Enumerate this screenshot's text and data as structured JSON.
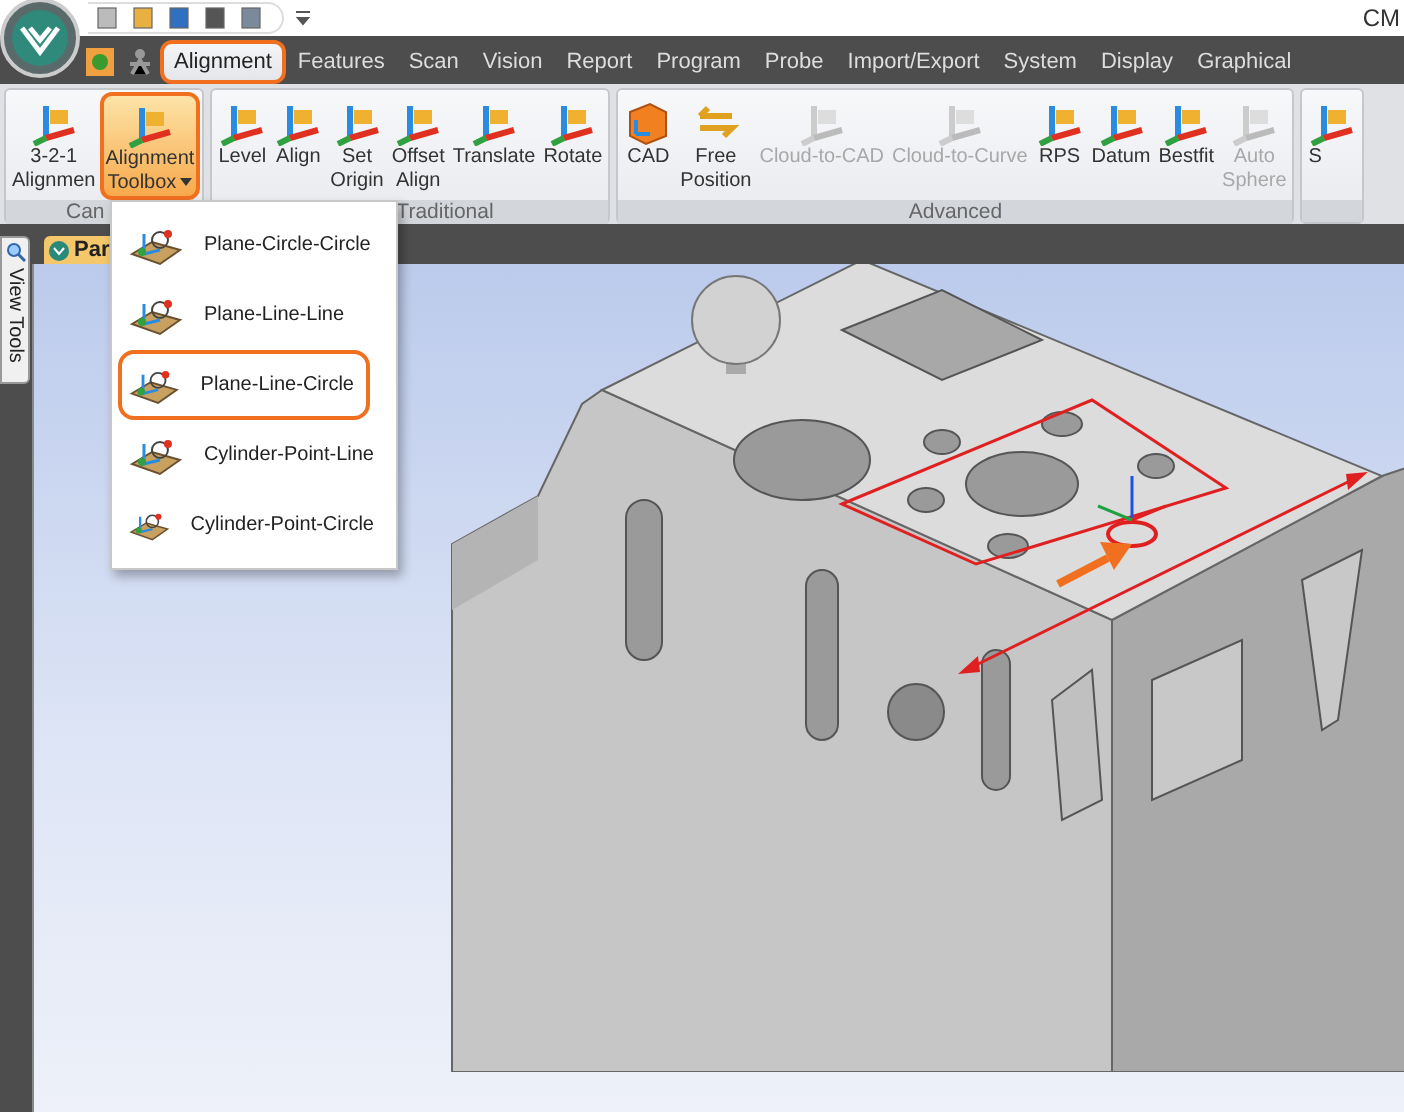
{
  "window": {
    "title": "CM"
  },
  "tabs": [
    {
      "label": "Alignment",
      "selected": true,
      "highlighted": true
    },
    {
      "label": "Features",
      "selected": false,
      "highlighted": false
    },
    {
      "label": "Scan",
      "selected": false,
      "highlighted": false
    },
    {
      "label": "Vision",
      "selected": false,
      "highlighted": false
    },
    {
      "label": "Report",
      "selected": false,
      "highlighted": false
    },
    {
      "label": "Program",
      "selected": false,
      "highlighted": false
    },
    {
      "label": "Probe",
      "selected": false,
      "highlighted": false
    },
    {
      "label": "Import/Export",
      "selected": false,
      "highlighted": false
    },
    {
      "label": "System",
      "selected": false,
      "highlighted": false
    },
    {
      "label": "Display",
      "selected": false,
      "highlighted": false
    },
    {
      "label": "Graphical",
      "selected": false,
      "highlighted": false
    }
  ],
  "ribbon_groups": [
    {
      "label": "Can",
      "buttons": [
        {
          "label": "3-2-1\nAlignmen",
          "active": false,
          "disabled": false,
          "highlighted": false
        },
        {
          "label": "Alignment\nToolbox",
          "dropdown": true,
          "active": true,
          "disabled": false,
          "highlighted": true
        }
      ]
    },
    {
      "label": "Traditional",
      "buttons": [
        {
          "label": "Level",
          "active": false,
          "disabled": false,
          "highlighted": false
        },
        {
          "label": "Align",
          "active": false,
          "disabled": false,
          "highlighted": false
        },
        {
          "label": "Set\nOrigin",
          "active": false,
          "disabled": false,
          "highlighted": false
        },
        {
          "label": "Offset\nAlign",
          "active": false,
          "disabled": false,
          "highlighted": false
        },
        {
          "label": "Translate",
          "active": false,
          "disabled": false,
          "highlighted": false
        },
        {
          "label": "Rotate",
          "active": false,
          "disabled": false,
          "highlighted": false
        }
      ]
    },
    {
      "label": "Advanced",
      "buttons": [
        {
          "label": "CAD",
          "active": false,
          "disabled": false,
          "highlighted": false
        },
        {
          "label": "Free\nPosition",
          "active": false,
          "disabled": false,
          "highlighted": false
        },
        {
          "label": "Cloud-to-CAD",
          "active": false,
          "disabled": true,
          "highlighted": false
        },
        {
          "label": "Cloud-to-Curve",
          "active": false,
          "disabled": true,
          "highlighted": false
        },
        {
          "label": "RPS",
          "active": false,
          "disabled": false,
          "highlighted": false
        },
        {
          "label": "Datum",
          "active": false,
          "disabled": false,
          "highlighted": false
        },
        {
          "label": "Bestfit",
          "active": false,
          "disabled": false,
          "highlighted": false
        },
        {
          "label": "Auto\nSphere",
          "active": false,
          "disabled": true,
          "highlighted": false
        }
      ]
    },
    {
      "buttons": [
        {
          "label": "S",
          "active": false,
          "disabled": false,
          "highlighted": false
        }
      ]
    }
  ],
  "dropdown_menu": [
    {
      "label": "Plane-Circle-Circle",
      "highlighted": false
    },
    {
      "label": "Plane-Line-Line",
      "highlighted": false
    },
    {
      "label": "Plane-Line-Circle",
      "highlighted": true
    },
    {
      "label": "Cylinder-Point-Line",
      "highlighted": false
    },
    {
      "label": "Cylinder-Point-Circle",
      "highlighted": false
    }
  ],
  "side_tab": {
    "label": "View Tools"
  },
  "document_tab": {
    "label": "Par",
    "selected": true
  }
}
